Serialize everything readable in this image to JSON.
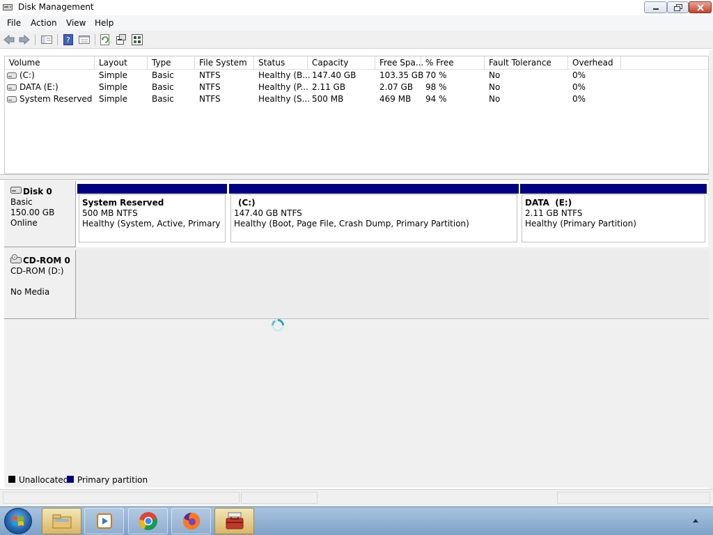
{
  "window": {
    "title": "Disk Management"
  },
  "menu": [
    "File",
    "Action",
    "View",
    "Help"
  ],
  "volume_list": {
    "columns": [
      "Volume",
      "Layout",
      "Type",
      "File System",
      "Status",
      "Capacity",
      "Free Spa...",
      "% Free",
      "Fault Tolerance",
      "Overhead"
    ],
    "rows": [
      [
        "(C:)",
        "Simple",
        "Basic",
        "NTFS",
        "Healthy (B...",
        "147.40 GB",
        "103.35 GB",
        "70 %",
        "No",
        "0%"
      ],
      [
        "DATA (E:)",
        "Simple",
        "Basic",
        "NTFS",
        "Healthy (P...",
        "2.11 GB",
        "2.07 GB",
        "98 %",
        "No",
        "0%"
      ],
      [
        "System Reserved",
        "Simple",
        "Basic",
        "NTFS",
        "Healthy (S...",
        "500 MB",
        "469 MB",
        "94 %",
        "No",
        "0%"
      ]
    ]
  },
  "disks": [
    {
      "name": "Disk 0",
      "type": "Basic",
      "size": "150.00 GB",
      "state": "Online",
      "partitions": [
        {
          "title": "System Reserved",
          "size": "500 MB NTFS",
          "status": "Healthy (System, Active, Primary Partit"
        },
        {
          "title": "(C:)",
          "size": "147.40 GB NTFS",
          "status": "Healthy (Boot, Page File, Crash Dump, Primary Partition)"
        },
        {
          "title": "DATA  (E:)",
          "size": "2.11 GB NTFS",
          "status": "Healthy (Primary Partition)"
        }
      ]
    },
    {
      "name": "CD-ROM 0",
      "type": "CD-ROM (D:)",
      "state": "No Media"
    }
  ],
  "legend": [
    {
      "label": "Unallocated",
      "color": "#000000"
    },
    {
      "label": "Primary partition",
      "color": "#000080"
    }
  ],
  "icons": {
    "toolbar": [
      "back-arrow-icon",
      "forward-arrow-icon",
      "show-hide-console-tree-icon",
      "help-icon",
      "properties-icon",
      "refresh-icon",
      "export-list-icon",
      "settings-icon"
    ],
    "taskbar": [
      "start-orb-icon",
      "file-explorer-icon",
      "media-player-icon",
      "chrome-icon",
      "firefox-icon",
      "toolbox-app-icon",
      "tray-up-arrow-icon"
    ]
  }
}
